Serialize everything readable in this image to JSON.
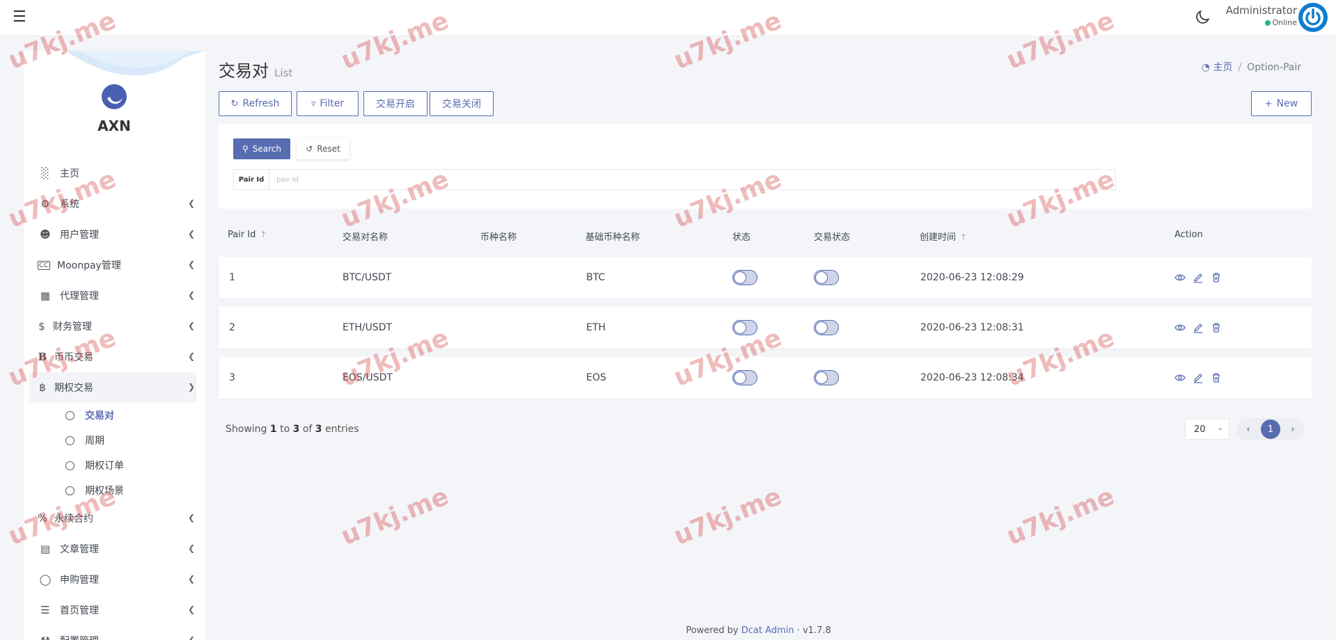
{
  "header": {
    "user_name": "Administrator",
    "user_status": "Online"
  },
  "sidebar": {
    "brand": "AXN",
    "menu": [
      {
        "label": "主页",
        "icon": "bar-chart-icon",
        "has_children": false
      },
      {
        "label": "系统",
        "icon": "gear-icon",
        "has_children": true
      },
      {
        "label": "用户管理",
        "icon": "users-icon",
        "has_children": true
      },
      {
        "label": "Moonpay管理",
        "icon": "cc-icon",
        "has_children": true
      },
      {
        "label": "代理管理",
        "icon": "id-card-icon",
        "has_children": true
      },
      {
        "label": "财务管理",
        "icon": "dollar-icon",
        "has_children": true
      },
      {
        "label": "币币交易",
        "icon": "bitcoin-b-icon",
        "has_children": true
      },
      {
        "label": "期权交易",
        "icon": "bitcoin-icon",
        "has_children": true,
        "open": true
      }
    ],
    "submenu": [
      {
        "label": "交易对",
        "active": true
      },
      {
        "label": "周期",
        "active": false
      },
      {
        "label": "期权订单",
        "active": false
      },
      {
        "label": "期权场景",
        "active": false
      }
    ],
    "menu_after": [
      {
        "label": "永续合约",
        "icon": "percent-icon"
      },
      {
        "label": "文章管理",
        "icon": "newspaper-icon"
      },
      {
        "label": "申购管理",
        "icon": "lifebuoy-icon"
      },
      {
        "label": "首页管理",
        "icon": "list-icon"
      },
      {
        "label": "配置管理",
        "icon": "wrench-icon"
      }
    ]
  },
  "page": {
    "title": "交易对",
    "subtitle": "List",
    "breadcrumb_home": "主页",
    "breadcrumb_current": "Option-Pair"
  },
  "toolbar": {
    "refresh": "Refresh",
    "filter": "Filter",
    "open_trading": "交易开启",
    "close_trading": "交易关闭",
    "new": "New"
  },
  "filter": {
    "search": "Search",
    "reset": "Reset",
    "pair_id_label": "Pair Id",
    "pair_id_placeholder": "pair id",
    "pair_id_value": ""
  },
  "table": {
    "headers": {
      "pair_id": "Pair Id",
      "pair_name": "交易对名称",
      "coin_name": "币种名称",
      "base_coin": "基础币种名称",
      "status": "状态",
      "trade_status": "交易状态",
      "created_at": "创建时间",
      "action": "Action"
    },
    "rows": [
      {
        "pair_id": "1",
        "pair_name": "BTC/USDT",
        "coin_name": "",
        "base_coin": "BTC",
        "status": false,
        "trade_status": false,
        "created_at": "2020-06-23 12:08:29"
      },
      {
        "pair_id": "2",
        "pair_name": "ETH/USDT",
        "coin_name": "",
        "base_coin": "ETH",
        "status": false,
        "trade_status": false,
        "created_at": "2020-06-23 12:08:31"
      },
      {
        "pair_id": "3",
        "pair_name": "EOS/USDT",
        "coin_name": "",
        "base_coin": "EOS",
        "status": false,
        "trade_status": false,
        "created_at": "2020-06-23 12:08:34"
      }
    ]
  },
  "pagination": {
    "showing_prefix": "Showing",
    "from": "1",
    "to_word": "to",
    "to": "3",
    "of_word": "of",
    "total": "3",
    "entries_word": "entries",
    "per_page": "20",
    "current_page": "1"
  },
  "footer": {
    "powered_by": "Powered by",
    "link": "Dcat Admin",
    "sep": "·",
    "version": "v1.7.8"
  },
  "watermark": "u7kj.me",
  "colors": {
    "primary": "#586cb1",
    "online": "#21b978"
  }
}
